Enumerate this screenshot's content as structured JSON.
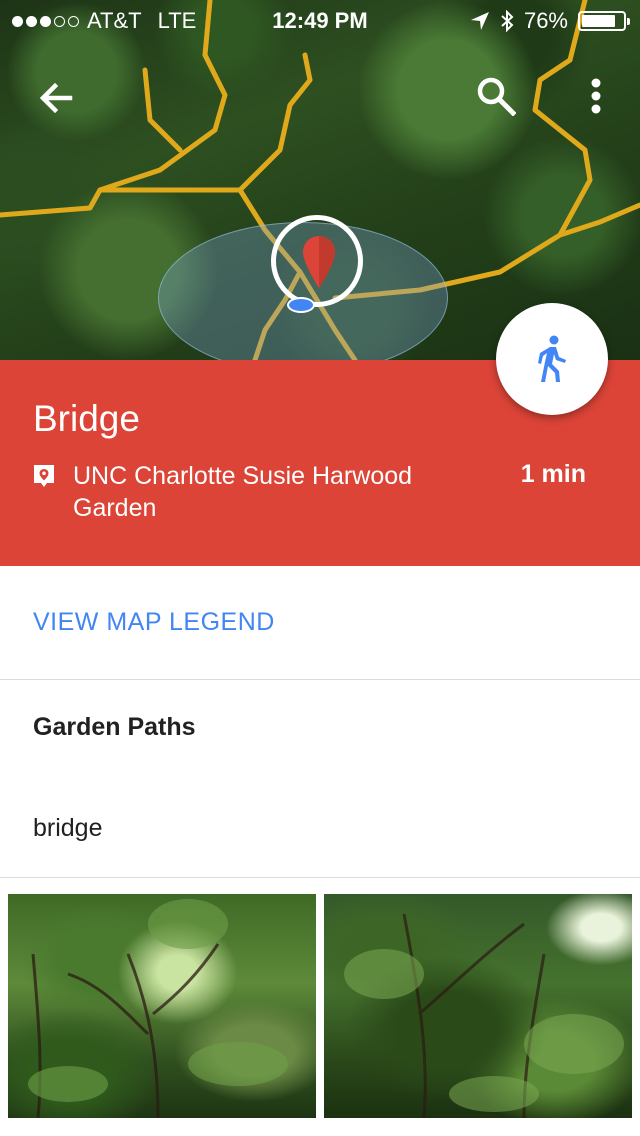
{
  "status_bar": {
    "carrier": "AT&T",
    "network": "LTE",
    "time": "12:49 PM",
    "battery_percent": "76%",
    "battery_level": 0.76,
    "signal_bars": 3,
    "signal_bars_total": 5
  },
  "toolbar": {
    "back_icon": "arrow-left-icon",
    "search_icon": "search-icon",
    "more_icon": "more-vertical-icon"
  },
  "place": {
    "name": "Bridge",
    "location": "UNC Charlotte Susie Harwood Garden",
    "eta": "1 min",
    "mode_icon": "walking-icon",
    "accent_color": "#db4437"
  },
  "legend_link": "VIEW MAP LEGEND",
  "details": {
    "section_title": "Garden Paths",
    "description": "bridge"
  },
  "colors": {
    "link": "#4285f4",
    "path": "#e0a91b",
    "pin": "#db4437"
  }
}
